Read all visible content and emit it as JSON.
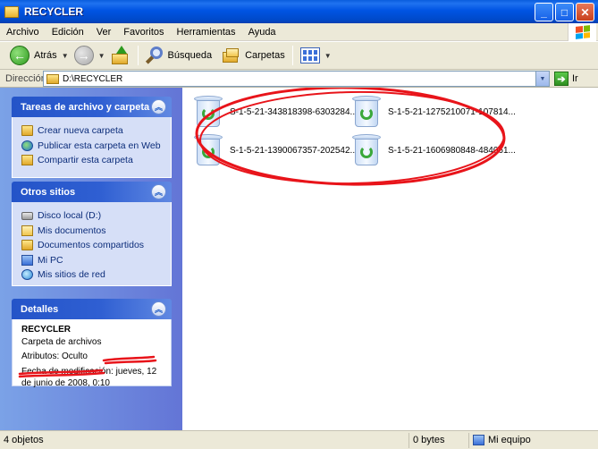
{
  "window": {
    "title": "RECYCLER"
  },
  "menu": [
    "Archivo",
    "Edición",
    "Ver",
    "Favoritos",
    "Herramientas",
    "Ayuda"
  ],
  "toolbar": {
    "back_label": "Atrás",
    "search_label": "Búsqueda",
    "folders_label": "Carpetas"
  },
  "address": {
    "label": "Dirección",
    "value": "D:\\RECYCLER",
    "go_label": "Ir"
  },
  "sidebar": {
    "tasks": {
      "title": "Tareas de archivo y carpeta",
      "items": [
        {
          "label": "Crear nueva carpeta",
          "icon": "new-folder-icon"
        },
        {
          "label": "Publicar esta carpeta en Web",
          "icon": "globe-icon"
        },
        {
          "label": "Compartir esta carpeta",
          "icon": "share-folder-icon"
        }
      ]
    },
    "places": {
      "title": "Otros sitios",
      "items": [
        {
          "label": "Disco local (D:)",
          "icon": "drive-icon"
        },
        {
          "label": "Mis documentos",
          "icon": "documents-folder-icon"
        },
        {
          "label": "Documentos compartidos",
          "icon": "shared-folder-icon"
        },
        {
          "label": "Mi PC",
          "icon": "computer-icon"
        },
        {
          "label": "Mis sitios de red",
          "icon": "network-icon"
        }
      ]
    },
    "details": {
      "title": "Detalles",
      "name": "RECYCLER",
      "type": "Carpeta de archivos",
      "attributes": "Atributos: Oculto",
      "modified": "Fecha de modificación: jueves, 12 de junio de 2008, 0:10"
    }
  },
  "files": [
    {
      "label": "S-1-5-21-343818398-6303284...",
      "icon": "recycle-bin-icon"
    },
    {
      "label": "S-1-5-21-1275210071-107814...",
      "icon": "recycle-bin-icon"
    },
    {
      "label": "S-1-5-21-1390067357-202542...",
      "icon": "recycle-bin-icon"
    },
    {
      "label": "S-1-5-21-1606980848-484061...",
      "icon": "recycle-bin-icon"
    }
  ],
  "status": {
    "objects": "4 objetos",
    "size": "0 bytes",
    "location": "Mi equipo"
  },
  "colors": {
    "annotation": "#e8141a",
    "titlebar": "#0054e3",
    "sidebar": "#6f8fde"
  }
}
